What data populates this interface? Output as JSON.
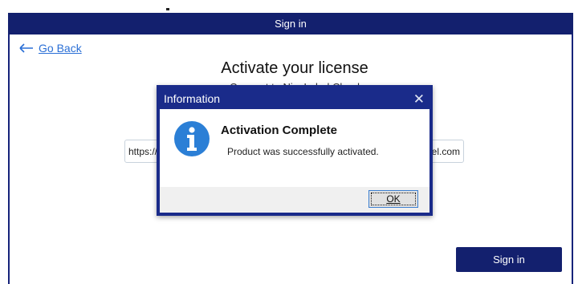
{
  "window": {
    "title": "Sign in"
  },
  "back_link": {
    "label": "Go Back"
  },
  "page": {
    "heading": "Activate your license",
    "subtitle": "Connect to NiceLabel Cloud"
  },
  "url_field": {
    "prefix": "https://",
    "suffix": "bel.com"
  },
  "signin_button": {
    "label": "Sign in"
  },
  "dialog": {
    "title": "Information",
    "close_glyph": "✕",
    "heading": "Activation Complete",
    "message": "Product was successfully activated.",
    "ok_label": "OK",
    "icon": "info-icon"
  },
  "colors": {
    "brand_navy": "#13206e",
    "dialog_frame": "#1a2b8a",
    "link_blue": "#2a6fd6",
    "info_blue": "#2b7fd6"
  }
}
